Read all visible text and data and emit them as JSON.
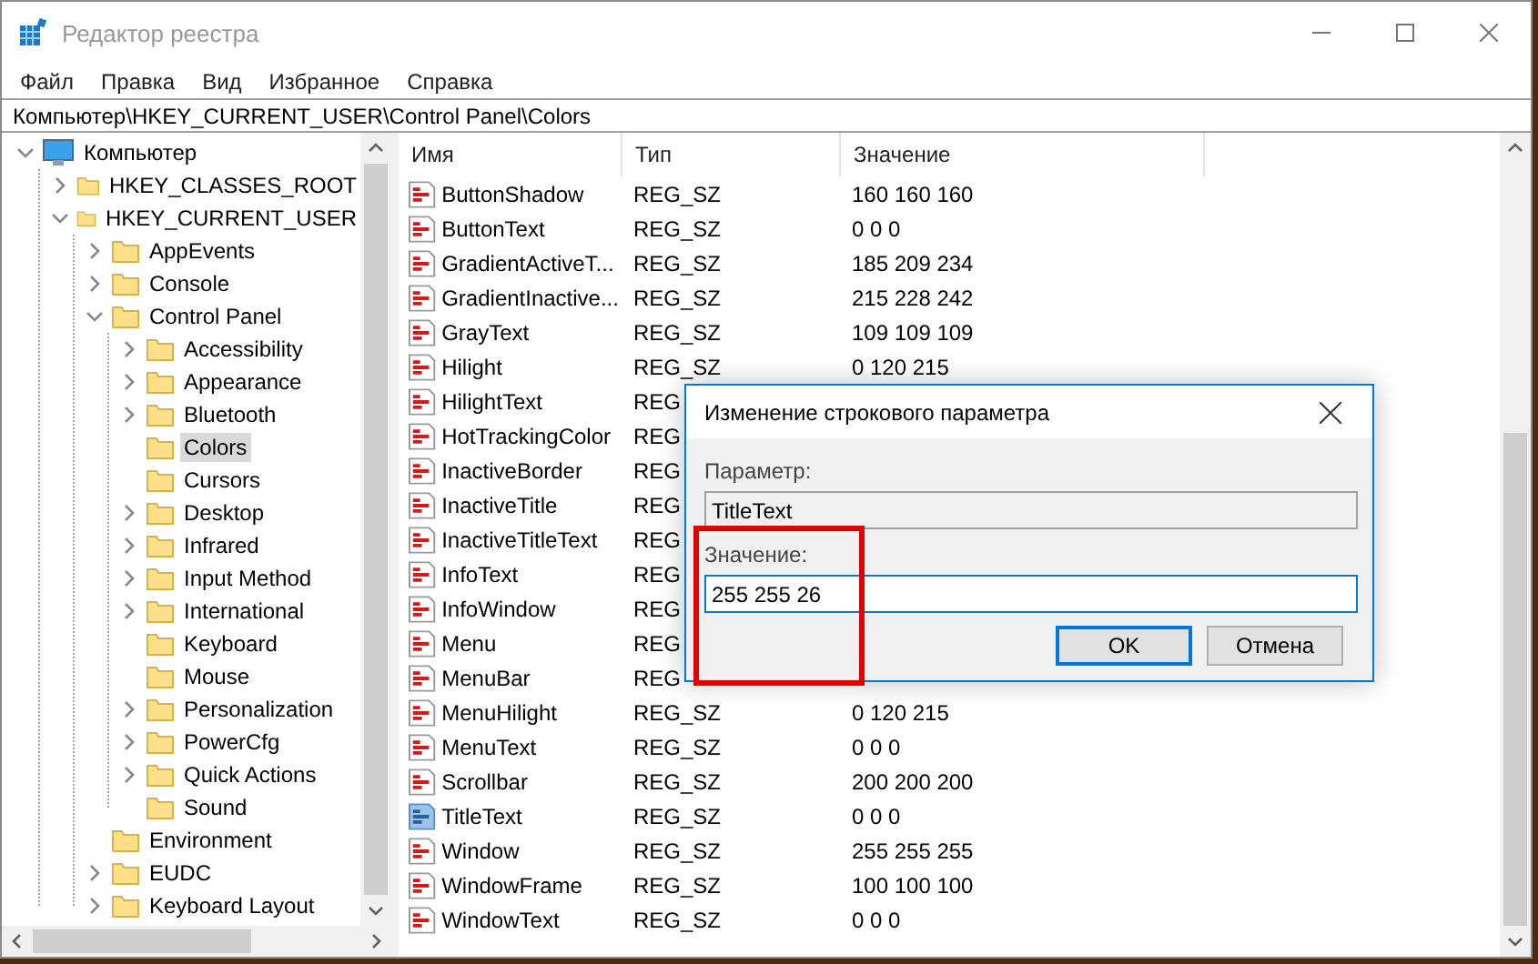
{
  "window": {
    "title": "Редактор реестра",
    "active": false
  },
  "menu": [
    "Файл",
    "Правка",
    "Вид",
    "Избранное",
    "Справка"
  ],
  "address": "Компьютер\\HKEY_CURRENT_USER\\Control Panel\\Colors",
  "tree": [
    {
      "label": "Компьютер",
      "kind": "computer",
      "expanded": true,
      "selected": false,
      "children": [
        {
          "label": "HKEY_CLASSES_ROOT",
          "kind": "folder",
          "expanded": false,
          "selected": false
        },
        {
          "label": "HKEY_CURRENT_USER",
          "kind": "folder",
          "expanded": true,
          "selected": false,
          "children": [
            {
              "label": "AppEvents",
              "kind": "folder",
              "expanded": false,
              "selected": false
            },
            {
              "label": "Console",
              "kind": "folder",
              "expanded": false,
              "selected": false
            },
            {
              "label": "Control Panel",
              "kind": "folder",
              "expanded": true,
              "selected": false,
              "children": [
                {
                  "label": "Accessibility",
                  "kind": "folder",
                  "expanded": false,
                  "selected": false
                },
                {
                  "label": "Appearance",
                  "kind": "folder",
                  "expanded": false,
                  "selected": false
                },
                {
                  "label": "Bluetooth",
                  "kind": "folder",
                  "expanded": false,
                  "selected": false
                },
                {
                  "label": "Colors",
                  "kind": "folder",
                  "selected": true
                },
                {
                  "label": "Cursors",
                  "kind": "folder",
                  "selected": false
                },
                {
                  "label": "Desktop",
                  "kind": "folder",
                  "expanded": false,
                  "selected": false
                },
                {
                  "label": "Infrared",
                  "kind": "folder",
                  "expanded": false,
                  "selected": false
                },
                {
                  "label": "Input Method",
                  "kind": "folder",
                  "expanded": false,
                  "selected": false
                },
                {
                  "label": "International",
                  "kind": "folder",
                  "expanded": false,
                  "selected": false
                },
                {
                  "label": "Keyboard",
                  "kind": "folder",
                  "selected": false
                },
                {
                  "label": "Mouse",
                  "kind": "folder",
                  "selected": false
                },
                {
                  "label": "Personalization",
                  "kind": "folder",
                  "expanded": false,
                  "selected": false
                },
                {
                  "label": "PowerCfg",
                  "kind": "folder",
                  "expanded": false,
                  "selected": false
                },
                {
                  "label": "Quick Actions",
                  "kind": "folder",
                  "expanded": false,
                  "selected": false
                },
                {
                  "label": "Sound",
                  "kind": "folder",
                  "selected": false
                }
              ]
            },
            {
              "label": "Environment",
              "kind": "folder",
              "selected": false
            },
            {
              "label": "EUDC",
              "kind": "folder",
              "expanded": false,
              "selected": false
            },
            {
              "label": "Keyboard Layout",
              "kind": "folder",
              "expanded": false,
              "selected": false
            }
          ]
        }
      ]
    }
  ],
  "values": {
    "columns": [
      "Имя",
      "Тип",
      "Значение"
    ],
    "rows": [
      {
        "name": "ButtonShadow",
        "type": "REG_SZ",
        "data": "160 160 160",
        "selected": false
      },
      {
        "name": "ButtonText",
        "type": "REG_SZ",
        "data": "0 0 0",
        "selected": false
      },
      {
        "name": "GradientActiveT...",
        "type": "REG_SZ",
        "data": "185 209 234",
        "selected": false
      },
      {
        "name": "GradientInactive...",
        "type": "REG_SZ",
        "data": "215 228 242",
        "selected": false
      },
      {
        "name": "GrayText",
        "type": "REG_SZ",
        "data": "109 109 109",
        "selected": false
      },
      {
        "name": "Hilight",
        "type": "REG_SZ",
        "data": "0 120 215",
        "selected": false
      },
      {
        "name": "HilightText",
        "type": "REG",
        "selected": false
      },
      {
        "name": "HotTrackingColor",
        "type": "REG",
        "selected": false
      },
      {
        "name": "InactiveBorder",
        "type": "REG",
        "selected": false
      },
      {
        "name": "InactiveTitle",
        "type": "REG",
        "selected": false
      },
      {
        "name": "InactiveTitleText",
        "type": "REG",
        "selected": false
      },
      {
        "name": "InfoText",
        "type": "REG",
        "selected": false
      },
      {
        "name": "InfoWindow",
        "type": "REG",
        "selected": false
      },
      {
        "name": "Menu",
        "type": "REG",
        "selected": false
      },
      {
        "name": "MenuBar",
        "type": "REG",
        "selected": false
      },
      {
        "name": "MenuHilight",
        "type": "REG_SZ",
        "data": "0 120 215",
        "selected": false
      },
      {
        "name": "MenuText",
        "type": "REG_SZ",
        "data": "0 0 0",
        "selected": false
      },
      {
        "name": "Scrollbar",
        "type": "REG_SZ",
        "data": "200 200 200",
        "selected": false
      },
      {
        "name": "TitleText",
        "type": "REG_SZ",
        "data": "0 0 0",
        "selected": true
      },
      {
        "name": "Window",
        "type": "REG_SZ",
        "data": "255 255 255",
        "selected": false
      },
      {
        "name": "WindowFrame",
        "type": "REG_SZ",
        "data": "100 100 100",
        "selected": false
      },
      {
        "name": "WindowText",
        "type": "REG_SZ",
        "data": "0 0 0",
        "selected": false
      }
    ]
  },
  "dialog": {
    "title": "Изменение строкового параметра",
    "parameter_label": "Параметр:",
    "parameter": "TitleText",
    "value_label": "Значение:",
    "value": "255 255 26",
    "highlighted": true,
    "buttons": [
      {
        "label": "OK",
        "default": true
      },
      {
        "label": "Отмена",
        "default": false
      }
    ]
  }
}
